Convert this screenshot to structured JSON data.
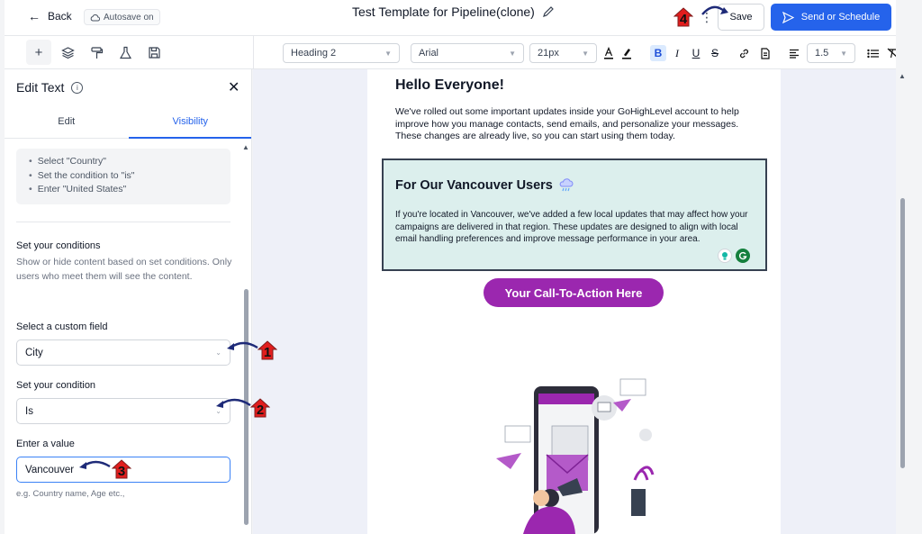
{
  "topbar": {
    "back_label": "Back",
    "autosave_label": "Autosave on",
    "title": "Test Template for Pipeline(clone)",
    "save_label": "Save",
    "send_label": "Send or Schedule"
  },
  "toolbar": {
    "block_type": "Heading 2",
    "font_family": "Arial",
    "font_size": "21px",
    "line_height": "1.5"
  },
  "panel": {
    "title": "Edit Text",
    "tabs": [
      {
        "label": "Edit"
      },
      {
        "label": "Visibility"
      }
    ],
    "hint_items": [
      "Select \"Country\"",
      "Set the condition to \"is\"",
      "Enter \"United States\""
    ],
    "section_title": "Set your conditions",
    "section_desc": "Show or hide content based on set conditions. Only users who meet them will see the content.",
    "custom_field_label": "Select a custom field",
    "custom_field_value": "City",
    "condition_label": "Set your condition",
    "condition_value": "Is",
    "value_label": "Enter a value",
    "value_value": "Vancouver",
    "value_help": "e.g. Country name, Age etc.,"
  },
  "email": {
    "heading": "Hello Everyone!",
    "intro": "We've rolled out some important updates inside your GoHighLevel account to help improve how you manage contacts, send emails, and personalize your messages. These changes are already live, so you can start using them today.",
    "block_heading": "For Our Vancouver Users",
    "block_text": "If you're located in Vancouver, we've added a few local updates that may affect how your campaigns are delivered in that region. These updates are designed to align with local email handling preferences and improve message performance in your area.",
    "cta_label": "Your Call-To-Action Here"
  },
  "markers": [
    "1",
    "2",
    "3",
    "4"
  ],
  "colors": {
    "accent": "#2563eb",
    "cta": "#9b27af",
    "block_bg": "#dcefed",
    "marker": "#e11d1d"
  }
}
